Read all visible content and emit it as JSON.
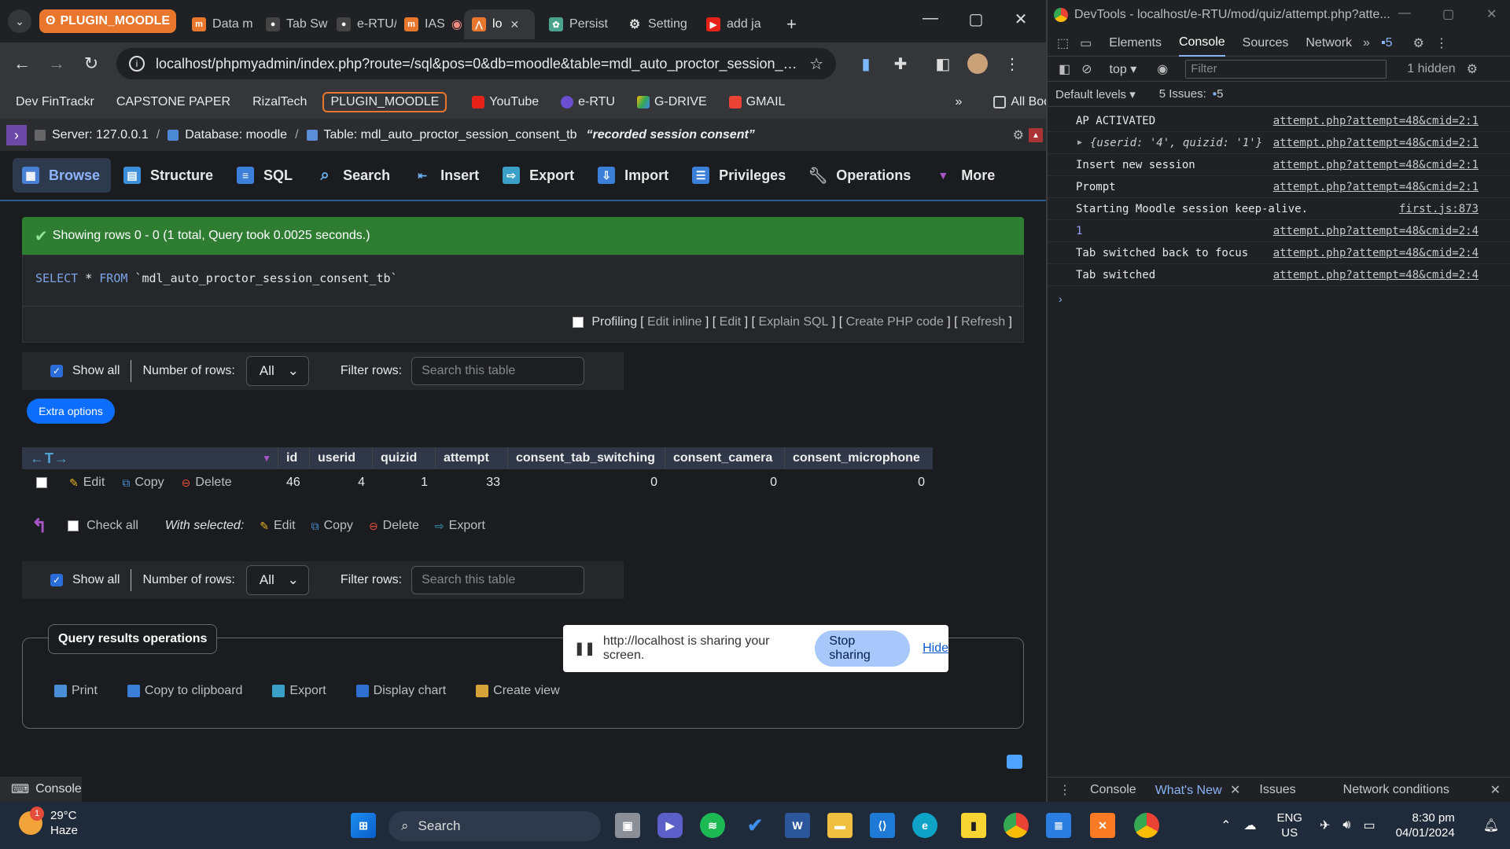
{
  "browser": {
    "tab_group_label": "PLUGIN_MOODLE",
    "tabs": [
      {
        "label": "Data m"
      },
      {
        "label": "Tab Sw"
      },
      {
        "label": "e-RTU/"
      },
      {
        "label": "IAS"
      },
      {
        "label": "lo"
      },
      {
        "label": "Persist"
      },
      {
        "label": "Setting"
      },
      {
        "label": "add ja"
      }
    ],
    "url": "localhost/phpmyadmin/index.php?route=/sql&pos=0&db=moodle&table=mdl_auto_proctor_session_c...",
    "bookmarks": [
      "Dev FinTrackr",
      "CAPSTONE PAPER",
      "RizalTech",
      "PLUGIN_MOODLE",
      "YouTube",
      "e-RTU",
      "G-DRIVE",
      "GMAIL"
    ],
    "all_bookmarks": "All Bookmarks"
  },
  "pma": {
    "breadcrumb": {
      "server": "Server: 127.0.0.1",
      "database": "Database: moodle",
      "table": "Table: mdl_auto_proctor_session_consent_tb",
      "comment": "“recorded session consent”"
    },
    "tabs": [
      "Browse",
      "Structure",
      "SQL",
      "Search",
      "Insert",
      "Export",
      "Import",
      "Privileges",
      "Operations",
      "More"
    ],
    "success_message": "Showing rows 0 - 0 (1 total, Query took 0.0025 seconds.)",
    "sql": {
      "select": "SELECT",
      "star": " * ",
      "from": "FROM ",
      "table": "`mdl_auto_proctor_session_consent_tb`"
    },
    "profiling": {
      "label": "Profiling",
      "links": [
        "Edit inline",
        "Edit",
        "Explain SQL",
        "Create PHP code",
        "Refresh"
      ]
    },
    "navbar": {
      "show_all": "Show all",
      "number_of_rows": "Number of rows:",
      "rows_value": "All",
      "filter_rows": "Filter rows:",
      "filter_placeholder": "Search this table"
    },
    "extra_options": "Extra options",
    "table": {
      "columns": [
        "id",
        "userid",
        "quizid",
        "attempt",
        "consent_tab_switching",
        "consent_camera",
        "consent_microphone"
      ],
      "rows": [
        {
          "id": "46",
          "userid": "4",
          "quizid": "1",
          "attempt": "33",
          "consent_tab_switching": "0",
          "consent_camera": "0",
          "consent_microphone": "0"
        }
      ],
      "row_actions": {
        "edit": "Edit",
        "copy": "Copy",
        "delete": "Delete"
      }
    },
    "with_selected": {
      "check_all": "Check all",
      "label": "With selected:",
      "actions": [
        "Edit",
        "Copy",
        "Delete",
        "Export"
      ]
    },
    "query_ops": {
      "title": "Query results operations",
      "items": [
        "Print",
        "Copy to clipboard",
        "Export",
        "Display chart",
        "Create view"
      ]
    },
    "console_label": "Console"
  },
  "share_bar": {
    "message": "http://localhost is sharing your screen.",
    "stop": "Stop sharing",
    "hide": "Hide"
  },
  "devtools": {
    "title": "DevTools - localhost/e-RTU/mod/quiz/attempt.php?atte...",
    "tabs": [
      "Elements",
      "Console",
      "Sources",
      "Network"
    ],
    "issues_badge": "5",
    "context": "top",
    "filter_placeholder": "Filter",
    "hidden": "1 hidden",
    "levels": "Default levels",
    "issues": "5 Issues:",
    "issues_count": "5",
    "logs": [
      {
        "text": "AP ACTIVATED",
        "src": "attempt.php?attempt=48&cmid=2:1"
      },
      {
        "text": "{userid: '4', quizid: '1'}",
        "src": "attempt.php?attempt=48&cmid=2:1"
      },
      {
        "text": "Insert new session",
        "src": "attempt.php?attempt=48&cmid=2:1"
      },
      {
        "text": "Prompt",
        "src": "attempt.php?attempt=48&cmid=2:1"
      },
      {
        "text": "Starting Moodle session keep-alive.",
        "src": "first.js:873"
      },
      {
        "text": "1",
        "src": "attempt.php?attempt=48&cmid=2:4"
      },
      {
        "text": "Tab switched back to focus",
        "src": "attempt.php?attempt=48&cmid=2:4"
      },
      {
        "text": "Tab switched",
        "src": "attempt.php?attempt=48&cmid=2:4"
      }
    ],
    "drawer_tabs": [
      "Console",
      "What's New",
      "Issues",
      "Network conditions"
    ]
  },
  "taskbar": {
    "weather_temp": "29°C",
    "weather_desc": "Haze",
    "weather_badge": "1",
    "search": "Search",
    "lang_top": "ENG",
    "lang_bottom": "US",
    "time": "8:30 pm",
    "date": "04/01/2024"
  }
}
